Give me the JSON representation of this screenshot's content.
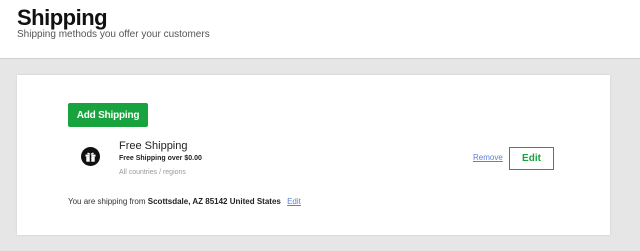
{
  "header": {
    "title": "Shipping",
    "subtitle": "Shipping methods you offer your customers"
  },
  "toolbar": {
    "add_label": "Add Shipping"
  },
  "methods": [
    {
      "icon": "gift-icon",
      "name": "Free Shipping",
      "description": "Free Shipping over $0.00",
      "regions": "All countries / regions",
      "remove_label": "Remove",
      "edit_label": "Edit"
    }
  ],
  "ship_from": {
    "prefix": "You are shipping from",
    "address": "Scottsdale, AZ 85142 United States",
    "edit_label": "Edit"
  },
  "colors": {
    "accent_green": "#19a33f",
    "link_blue": "#5b7fd6",
    "background": "#e6e6e6"
  }
}
